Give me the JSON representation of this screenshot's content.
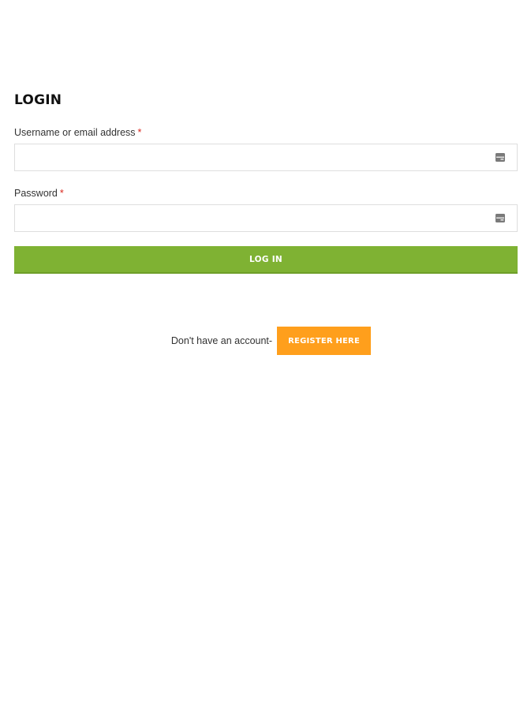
{
  "login": {
    "title": "LOGIN",
    "username": {
      "label": "Username or email address",
      "required_mark": "*",
      "value": "",
      "autofill_icon": "autofill-card-icon"
    },
    "password": {
      "label": "Password",
      "required_mark": "*",
      "value": "",
      "autofill_icon": "autofill-card-icon"
    },
    "submit_label": "LOG IN"
  },
  "register": {
    "prompt": "Don't have an account-",
    "button_label": "REGISTER HERE"
  },
  "colors": {
    "login_button": "#7fb233",
    "register_button": "#ff9f1c",
    "required_star": "#d9261c"
  }
}
